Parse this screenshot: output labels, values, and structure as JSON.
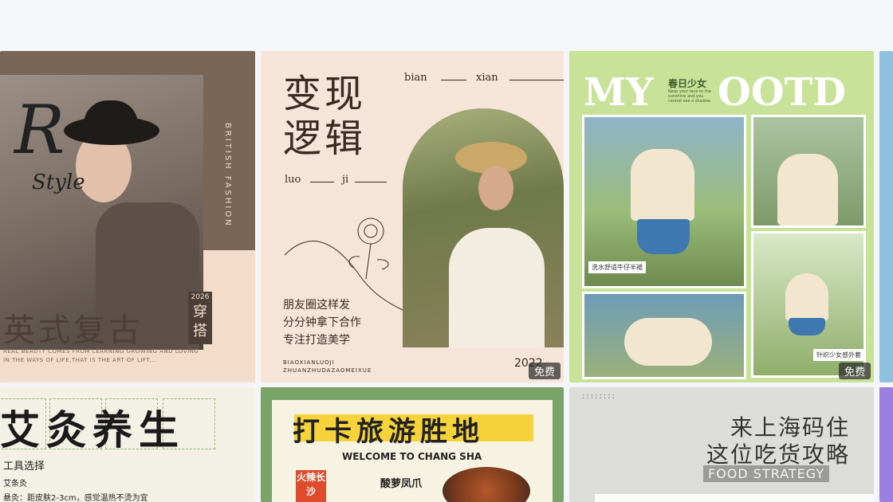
{
  "cards": [
    {
      "script": "R",
      "script_sub": "Style",
      "vertical": "BRITISH FASHION",
      "title": "英式复古",
      "year": "2026",
      "title_side": "穿搭",
      "small_text": "REAL BEAUTY COMES FROM LEARNING GROWING AND LOVING IN THE WAYS OF LIFE,THAT IS THE ART OF LIFT..."
    },
    {
      "title": "变现逻辑",
      "pinyin_top_1": "bian",
      "pinyin_top_2": "xian",
      "pinyin_mid_1": "luo",
      "pinyin_mid_2": "ji",
      "lines": [
        "朋友圈这样发",
        "分分钟拿下合作",
        "专注打造美学"
      ],
      "footer_1": "BIAOXIANLUOJI",
      "footer_2": "ZHUANZHUDAZAOMEIXUE",
      "year": "2022",
      "badge": "免费"
    },
    {
      "title_left": "MY",
      "title_right": "OOTD",
      "tag": "春日少女",
      "tag_sub": "Keep your face to the sunshine and you cannot see a shadow",
      "caption_1": "洗水舒适牛仔半裙",
      "caption_2": "针织少女感外套",
      "badge": "免费"
    },
    {
      "title": "艾灸养生",
      "sub": "工具选择",
      "sub2": "艾条灸",
      "sub3": "悬灸：距皮肤2-3cm，感觉温热不烫为宜"
    },
    {
      "title": "打卡旅游胜地",
      "welcome": "WELCOME TO CHANG SHA",
      "red_label": "火辣长沙",
      "dish": "酸萝凤爪"
    },
    {
      "dots": "::::::::",
      "title_1": "来上海码住",
      "title_2": "这位吃货攻略",
      "en": "FOOD STRATEGY"
    }
  ]
}
